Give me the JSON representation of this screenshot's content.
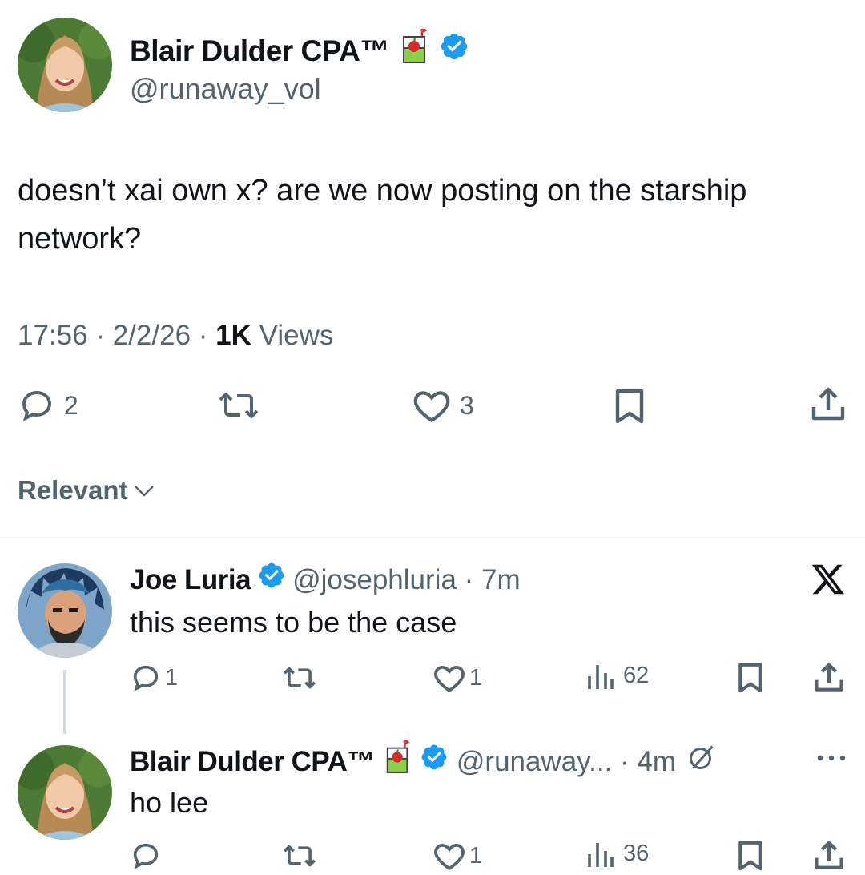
{
  "main_tweet": {
    "author_name": "Blair Dulder CPA™",
    "author_handle": "@runaway_vol",
    "text": "doesn’t xai own x? are we now posting on the starship network?",
    "time": "17:56",
    "date": "2/2/26",
    "views_count": "1K",
    "views_label": "Views",
    "replies": "2",
    "likes": "3"
  },
  "sort": {
    "label": "Relevant"
  },
  "replies": [
    {
      "author_name": "Joe Luria",
      "author_handle": "@josephluria",
      "time": "7m",
      "text": "this seems to be the case",
      "replies": "1",
      "likes": "1",
      "views": "62"
    },
    {
      "author_name": "Blair Dulder CPA™",
      "author_handle": "@runaway...",
      "time": "4m",
      "text": "ho lee",
      "likes": "1",
      "views": "36"
    }
  ],
  "colors": {
    "verified": "#1d9bf0",
    "muted": "#536471",
    "text": "#0f1419"
  }
}
